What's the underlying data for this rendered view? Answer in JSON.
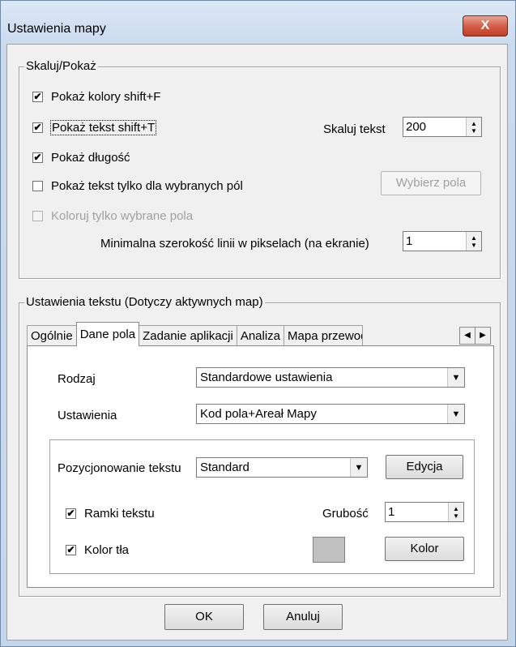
{
  "window": {
    "title": "Ustawienia mapy",
    "close_glyph": "X"
  },
  "scale_group": {
    "legend": "Skaluj/Pokaż",
    "show_colors": {
      "label": "Pokaż kolory shift+F",
      "checked": true
    },
    "show_text": {
      "label": "Pokaż tekst  shift+T",
      "checked": true
    },
    "scale_text_label": "Skaluj tekst",
    "scale_text_value": "200",
    "show_length": {
      "label": "Pokaż długość",
      "checked": true
    },
    "text_selected_only": {
      "label": "Pokaż tekst tylko dla wybranych pól",
      "checked": false
    },
    "choose_fields_button": "Wybierz pola",
    "color_selected_only": {
      "label": "Koloruj tylko wybrane pola",
      "checked": false
    },
    "min_line_width_label": "Minimalna szerokość linii w pikselach (na ekranie)",
    "min_line_width_value": "1"
  },
  "text_group": {
    "legend": "Ustawienia tekstu  (Dotyczy aktywnych map)",
    "tabs": [
      "Ogólnie",
      "Dane pola",
      "Zadanie aplikacji",
      "Analiza",
      "Mapa przewodz"
    ],
    "active_tab": "Dane pola",
    "kind_label": "Rodzaj",
    "kind_value": "Standardowe ustawienia",
    "settings_label": "Ustawienia",
    "settings_value": "Kod pola+Areał Mapy",
    "positioning_label": "Pozycjonowanie tekstu",
    "positioning_value": "Standard",
    "edit_button": "Edycja",
    "text_frames": {
      "label": "Ramki tekstu",
      "checked": true
    },
    "thickness_label": "Grubość",
    "thickness_value": "1",
    "bg_color": {
      "label": "Kolor tła",
      "checked": true
    },
    "bg_swatch_color": "#c0c0c0",
    "color_button": "Kolor"
  },
  "footer": {
    "ok": "OK",
    "cancel": "Anuluj"
  }
}
